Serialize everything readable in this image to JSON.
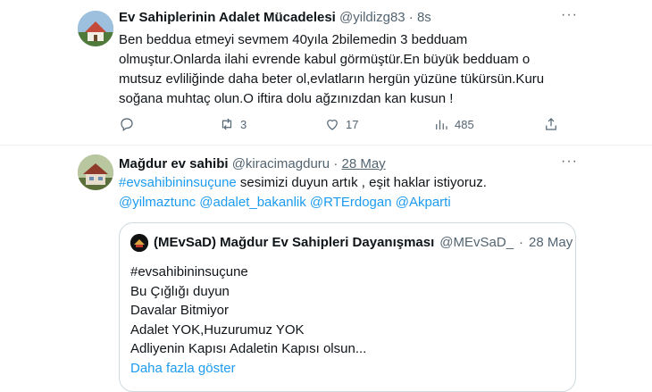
{
  "tweet1": {
    "name": "Ev Sahiplerinin Adalet Mücadelesi",
    "handle": "@yildizg83",
    "dot": "·",
    "time": "8s",
    "more": "···",
    "lines": [
      "Ben beddua etmeyi sevmem 40yıla 2bilemedin 3 bedduam",
      "olmuştur.Onlarda ilahi evrende kabul görmüştür.En büyük bedduam o",
      "mutsuz evliliğinde daha beter ol,evlatların hergün yüzüne tükürsün.Kuru",
      "soğana muhtaç olun.O iftira dolu ağzınızdan kan kusun !"
    ],
    "actions": {
      "retweets": "3",
      "likes": "17",
      "views": "485"
    }
  },
  "tweet2": {
    "name": "Mağdur ev sahibi",
    "handle": "@kiracimagduru",
    "dot": "·",
    "time": "28 May",
    "more": "···",
    "hashtag": "#evsahibininsuçune",
    "line1_rest": " sesimizi duyun artık , eşit haklar istiyoruz.",
    "mentions": [
      "@yilmaztunc",
      "@adalet_bakanlik",
      "@RTErdogan",
      "@Akparti"
    ]
  },
  "quote": {
    "name": "(MEvSaD) Mağdur Ev Sahipleri Dayanışması",
    "handle": "@MEvSaD_",
    "dot": "·",
    "time": "28 May",
    "lines": [
      "#evsahibininsuçune",
      "Bu Çığlığı duyun",
      "Davalar Bitmiyor",
      "Adalet YOK,Huzurumuz YOK",
      "Adliyenin Kapısı Adaletin Kapısı olsun..."
    ],
    "show_more": "Daha fazla göster"
  },
  "colors": {
    "link": "#1d9bf0",
    "secondary": "#536471",
    "text": "#0f1419",
    "border": "#cfd9de"
  }
}
